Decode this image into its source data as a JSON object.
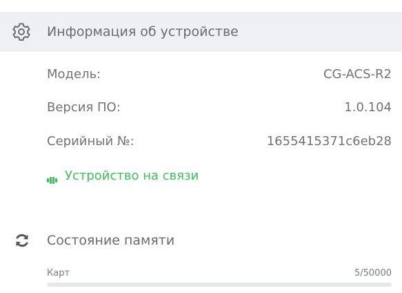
{
  "device_info": {
    "title": "Информация об устройстве",
    "icon": "gear-icon",
    "fields": [
      {
        "label": "Модель:",
        "value": "CG-ACS-R2"
      },
      {
        "label": "Версия ПО:",
        "value": "1.0.104"
      },
      {
        "label": "Серийный №:",
        "value": "1655415371c6eb28"
      }
    ],
    "status": {
      "text": "Устройство на связи",
      "icon": "signal-icon",
      "color": "#3fbf5a"
    }
  },
  "memory": {
    "title": "Состояние памяти",
    "icon": "refresh-icon",
    "cards": {
      "label": "Карт",
      "value": "5/50000",
      "used": 5,
      "total": 50000
    }
  },
  "colors": {
    "header_bg": "#eef0f3",
    "accent_green": "#3fbf5a",
    "text_gray": "#6f6f6f"
  }
}
